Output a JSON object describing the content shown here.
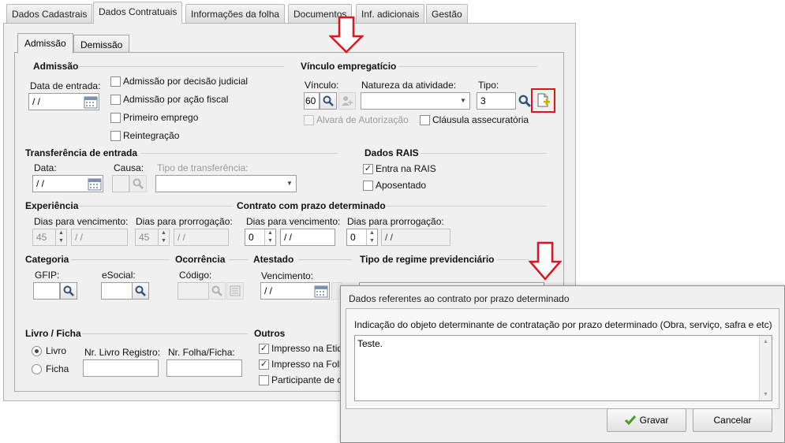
{
  "tabs": [
    "Dados Cadastrais",
    "Dados Contratuais",
    "Informações da folha",
    "Documentos",
    "Inf. adicionais",
    "Gestão"
  ],
  "subtabs": [
    "Admissão",
    "Demissão"
  ],
  "admissao": {
    "title": "Admissão",
    "data_entrada_label": "Data de entrada:",
    "data_entrada_value": " / /",
    "checks": [
      "Admissão por decisão judicial",
      "Admissão por ação fiscal",
      "Primeiro emprego",
      "Reintegração"
    ]
  },
  "vinculo": {
    "title": "Vínculo empregatício",
    "vinculo_label": "Vínculo:",
    "vinculo_value": "60",
    "natureza_label": "Natureza da atividade:",
    "tipo_label": "Tipo:",
    "tipo_value": "3",
    "alvara": "Alvará de Autorização",
    "clausula": "Cláusula assecuratória"
  },
  "transferencia": {
    "title": "Transferência de entrada",
    "data_label": "Data:",
    "data_value": " / /",
    "causa_label": "Causa:",
    "tipo_label": "Tipo de transferência:"
  },
  "rais": {
    "title": "Dados RAIS",
    "entra": "Entra na RAIS",
    "entra_checked": true,
    "aposentado": "Aposentado"
  },
  "experiencia": {
    "title": "Experiência",
    "venc_label": "Dias para vencimento:",
    "venc_value": "45",
    "venc_date": " / /",
    "prorr_label": "Dias para prorrogação:",
    "prorr_value": "45",
    "prorr_date": " / /"
  },
  "contrato": {
    "title": "Contrato com prazo determinado",
    "venc_label": "Dias para vencimento:",
    "venc_value": "0",
    "venc_date": " / /",
    "prorr_label": "Dias para prorrogação:",
    "prorr_value": "0",
    "prorr_date": " / /"
  },
  "categoria": {
    "title": "Categoria",
    "gfip_label": "GFIP:",
    "esocial_label": "eSocial:"
  },
  "ocorrencia": {
    "title": "Ocorrência",
    "codigo_label": "Código:"
  },
  "atestado": {
    "title": "Atestado",
    "venc_label": "Vencimento:",
    "venc_value": " / /"
  },
  "regime": {
    "title": "Tipo de regime previdenciário"
  },
  "livro": {
    "title": "Livro / Ficha",
    "opt_livro": "Livro",
    "opt_ficha": "Ficha",
    "nr_livro_label": "Nr. Livro Registro:",
    "nr_folha_label": "Nr. Folha/Ficha:"
  },
  "outros": {
    "title": "Outros",
    "items": [
      "Impresso na Etiq",
      "Impresso na Foll",
      "Participante de c"
    ]
  },
  "dialog": {
    "title": "Dados referentes ao contrato por prazo determinado",
    "prompt": "Indicação do objeto determinante de contratação por prazo determinado (Obra, serviço, safra e etc)",
    "text": "Teste.",
    "gravar": "Gravar",
    "cancelar": "Cancelar"
  },
  "colors": {
    "highlight_red": "#e0141e",
    "check_green": "#4a9a1e"
  }
}
